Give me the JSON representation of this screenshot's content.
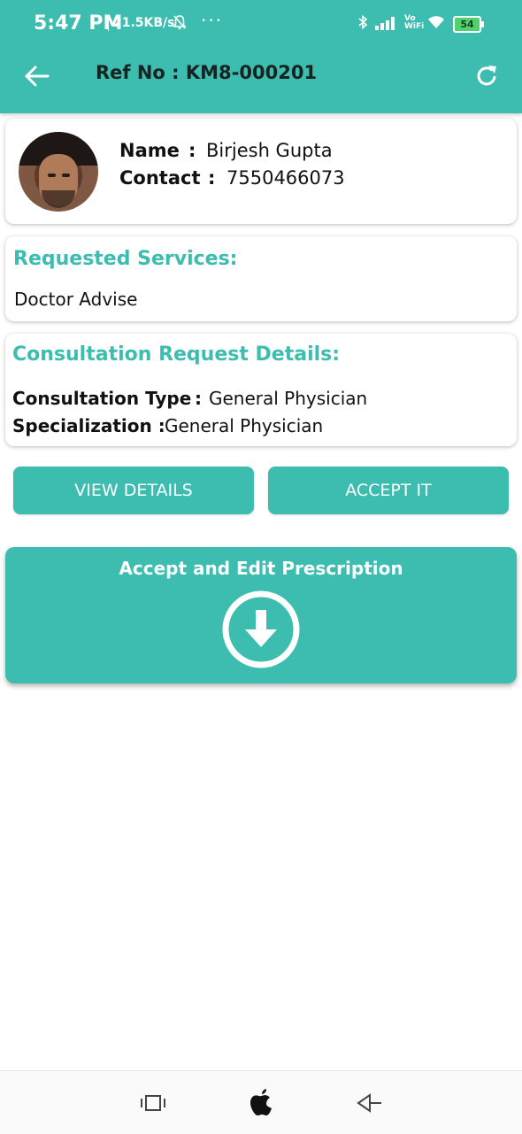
{
  "status_bar": {
    "time": "5:47 PM",
    "speed": "21.5KB/s",
    "dots": "···",
    "vowifi_top": "Vo",
    "vowifi_bottom": "WiFi",
    "battery": "54"
  },
  "header": {
    "title": "Ref No : KM8-000201"
  },
  "patient": {
    "name_label": "Name",
    "name_sep": ":",
    "name_value": "Birjesh Gupta",
    "contact_label": "Contact",
    "contact_sep": ":",
    "contact_value": "7550466073"
  },
  "services": {
    "title": "Requested Services:",
    "value": "Doctor Advise"
  },
  "consultation": {
    "title": "Consultation Request Details:",
    "type_label": "Consultation Type",
    "type_sep": ":",
    "type_value": "General Physician",
    "spec_label": "Specialization :",
    "spec_value": "General Physician"
  },
  "actions": {
    "view_details": "VIEW DETAILS",
    "accept": "ACCEPT IT",
    "accept_edit": "Accept and Edit Prescription"
  },
  "colors": {
    "accent": "#3dbdb0",
    "battery": "#4fd26d"
  },
  "icons": {
    "back": "arrow-left-icon",
    "refresh": "refresh-icon",
    "download": "download-circle-icon",
    "nav_recent": "recent-apps-icon",
    "nav_home": "apple-home-icon",
    "nav_back": "triangle-back-icon"
  }
}
